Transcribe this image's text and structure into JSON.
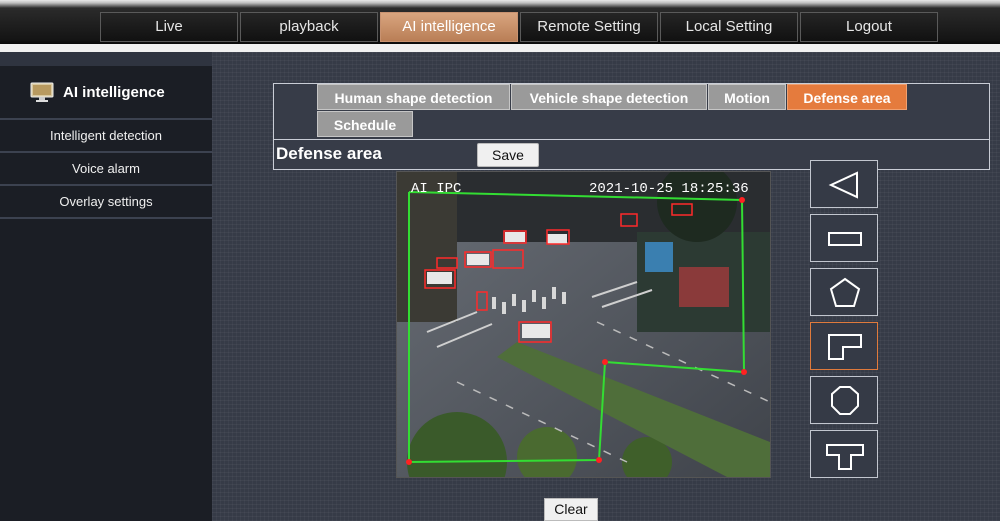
{
  "nav": {
    "items": [
      {
        "label": "Live"
      },
      {
        "label": "playback"
      },
      {
        "label": "AI intelligence"
      },
      {
        "label": "Remote Setting"
      },
      {
        "label": "Local Setting"
      },
      {
        "label": "Logout"
      }
    ],
    "active_index": 2
  },
  "sidebar": {
    "title": "AI intelligence",
    "icon": "monitor-icon",
    "items": [
      {
        "label": "Intelligent detection"
      },
      {
        "label": "Voice alarm"
      },
      {
        "label": "Overlay settings"
      }
    ]
  },
  "tabs": [
    {
      "label": "Human shape detection"
    },
    {
      "label": "Vehicle shape detection"
    },
    {
      "label": "Motion"
    },
    {
      "label": "Defense area"
    },
    {
      "label": "Schedule"
    }
  ],
  "active_tab": "Defense area",
  "section": {
    "title": "Defense area",
    "save_label": "Save",
    "clear_label": "Clear"
  },
  "video": {
    "osd_left": "AI IPC",
    "osd_timestamp": "2021-10-25 18:25:36"
  },
  "shape_tools": [
    {
      "name": "triangle-shape-icon",
      "selected": false
    },
    {
      "name": "rectangle-shape-icon",
      "selected": false
    },
    {
      "name": "pentagon-shape-icon",
      "selected": false
    },
    {
      "name": "l-shape-icon",
      "selected": true
    },
    {
      "name": "octagon-shape-icon",
      "selected": false
    },
    {
      "name": "t-shape-icon",
      "selected": false
    }
  ],
  "colors": {
    "accent": "#e57b3d",
    "nav_active": "#c48a62",
    "zone_line": "#33dd33",
    "zone_vertex": "#ff2222",
    "detection_box": "#ff2a2a"
  }
}
